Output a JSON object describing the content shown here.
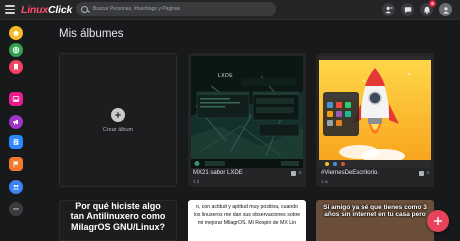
{
  "app": {
    "logo_part1": "Linux",
    "logo_part2": "Click"
  },
  "search": {
    "placeholder": "Buscar Personas, #hashtags y Páginas"
  },
  "topbar": {
    "notification_count": "6"
  },
  "sidebar": {
    "items": [
      {
        "icon": "home-icon",
        "color": "#f7b928"
      },
      {
        "icon": "globe-icon",
        "color": "#31a24c"
      },
      {
        "icon": "bookmark-icon",
        "color": "#f3425f"
      },
      {
        "icon": "image-icon",
        "color": "#e91e8c"
      },
      {
        "icon": "megaphone-icon",
        "color": "#a033c8"
      },
      {
        "icon": "page-icon",
        "color": "#2d88ff"
      },
      {
        "icon": "flag-icon",
        "color": "#f5792a"
      },
      {
        "icon": "group-icon",
        "color": "#3b82f6"
      },
      {
        "icon": "more-icon",
        "color": "#3a3b3d"
      }
    ]
  },
  "page": {
    "title": "Mis álbumes"
  },
  "create": {
    "label": "Crear álbum"
  },
  "albums": [
    {
      "title": "MX21 sabor LXDE",
      "subtitle": "3 d",
      "count": "4",
      "thumb_text": "LXDE"
    },
    {
      "title": "#ViernesDeEscritorio.",
      "subtitle": "1 w",
      "count": "4"
    }
  ],
  "bottom_cards": [
    {
      "text": "Por qué hiciste algo tan Antilinuxero como MilagrOS GNU/Linux?"
    },
    {
      "text": "o, con actitud y aptitud muy positiva, cuando los linuxeros me dan sus observaciones sobre mi mejorar MilagrOS. Mi Respin de MX Lin"
    },
    {
      "text": "Si amigo ya sé que tienes como 3 años sin internet en tu casa pero"
    }
  ],
  "colors": {
    "background": "#18191b",
    "card": "#242527",
    "accent": "#e8435a"
  }
}
